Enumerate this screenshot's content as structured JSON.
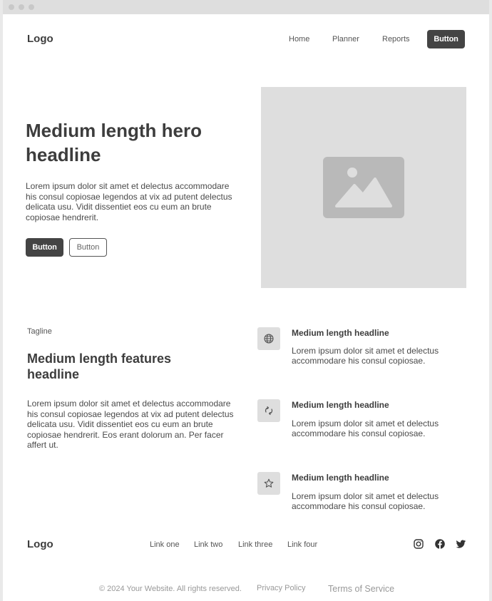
{
  "header": {
    "logo": "Logo",
    "nav": [
      "Home",
      "Planner",
      "Reports"
    ],
    "cta": "Button"
  },
  "hero": {
    "title": "Medium length hero headline",
    "body": "Lorem ipsum dolor sit amet et delectus accommodare his consul copiosae legendos at vix ad putent delectus delicata usu. Vidit dissentiet eos cu eum an brute copiosae hendrerit.",
    "primary_button": "Button",
    "secondary_button": "Button",
    "image_icon": "image-placeholder-icon"
  },
  "features": {
    "tagline": "Tagline",
    "title": "Medium length features headline",
    "body": "Lorem ipsum dolor sit amet et delectus accommodare his consul copiosae legendos at vix ad putent delectus delicata usu. Vidit dissentiet eos cu eum an brute copiosae hendrerit. Eos erant dolorum an. Per facer affert ut.",
    "items": [
      {
        "icon": "globe-icon",
        "title": "Medium length headline",
        "body": "Lorem ipsum dolor sit amet et delectus accommodare his consul copiosae."
      },
      {
        "icon": "refresh-icon",
        "title": "Medium length headline",
        "body": "Lorem ipsum dolor sit amet et delectus accommodare his consul copiosae."
      },
      {
        "icon": "star-icon",
        "title": "Medium length headline",
        "body": "Lorem ipsum dolor sit amet et delectus accommodare his consul copiosae."
      }
    ]
  },
  "footer": {
    "logo": "Logo",
    "links": [
      "Link one",
      "Link two",
      "Link three",
      "Link four"
    ],
    "social": [
      "instagram-icon",
      "facebook-icon",
      "twitter-icon"
    ],
    "copyright": "© 2024 Your Website. All rights reserved.",
    "privacy": "Privacy Policy",
    "terms": "Terms of Service"
  },
  "colors": {
    "dark_button": "#444444",
    "placeholder_bg": "#dedede",
    "placeholder_glyph": "#b9b9b9"
  }
}
